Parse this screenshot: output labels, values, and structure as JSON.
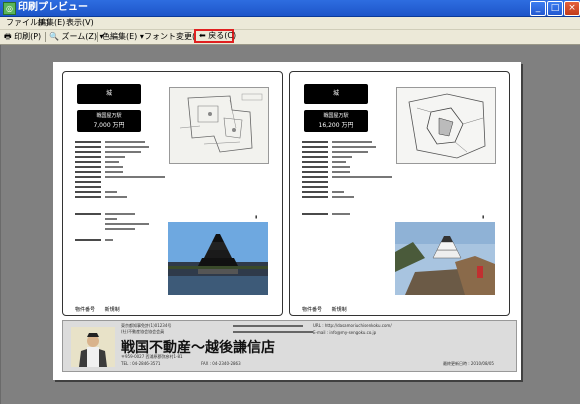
{
  "window": {
    "title": "印刷プレビュー"
  },
  "menu": {
    "items": [
      "ファイル(F)",
      "編集(E)",
      "表示(V)"
    ]
  },
  "toolbar": {
    "print": "印刷(P)",
    "zoom": "ズーム(Z)",
    "color_edit": "色編集(E)",
    "font_change": "フォント変更(E)",
    "close": "戻る(C)"
  },
  "cards": [
    {
      "badge": "城",
      "price_label": "戦国屋万駅",
      "price": "7,000 万円",
      "footer_label": "物件番号",
      "footer_value": "新規制"
    },
    {
      "badge": "城",
      "price_label": "戦国屋万駅",
      "price": "16,200 万円",
      "footer_label": "物件番号",
      "footer_value": "新規制"
    }
  ],
  "banner": {
    "company": "戦国不動産～越後謙信店",
    "line1": "東京都知事免許(1)01234号",
    "line2": "(社)不動産協会協会会員",
    "line3": "〒959-0027 西浦原郡弥彦村1-81",
    "url": "URL : http://dasamoriuchisenkoku.com/",
    "email": "E-mail : info@my-sengoku.co.jp",
    "date": "最終更新日時 : 2010/08/05",
    "tel": "TEL : 04-2846-3571",
    "fax": "FAX : 04-2340-2863"
  },
  "colors": {
    "highlight": "#e02020",
    "titlebar": "#2e6de0"
  }
}
